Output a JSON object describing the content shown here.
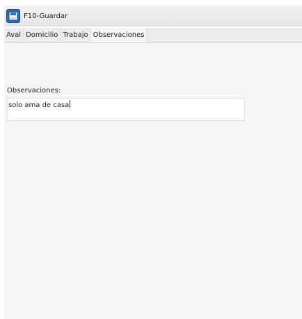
{
  "toolbar": {
    "save_label": "F10-Guardar",
    "save_icon": "save-icon"
  },
  "tabs": [
    {
      "label": "Aval",
      "active": false
    },
    {
      "label": "Domicilio",
      "active": false
    },
    {
      "label": "Trabajo",
      "active": false
    },
    {
      "label": "Observaciones",
      "active": true
    }
  ],
  "observaciones": {
    "label": "Observaciones:",
    "value": "solo ama de casa"
  },
  "colors": {
    "accent": "#2b6fb6",
    "panel_bg": "#f5f5f5"
  }
}
